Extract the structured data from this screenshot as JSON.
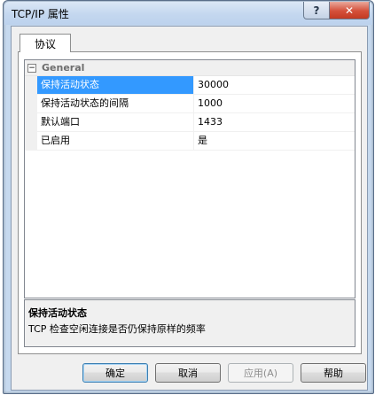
{
  "window": {
    "title": "TCP/IP 属性",
    "help_glyph": "?",
    "close_glyph": "✕"
  },
  "tabs": [
    {
      "label": "协议"
    }
  ],
  "grid": {
    "category": {
      "label": "General",
      "toggle": "−"
    },
    "properties": [
      {
        "name": "保持活动状态",
        "value": "30000",
        "selected": true
      },
      {
        "name": "保持活动状态的间隔",
        "value": "1000",
        "selected": false
      },
      {
        "name": "默认端口",
        "value": "1433",
        "selected": false
      },
      {
        "name": "已启用",
        "value": "是",
        "selected": false
      }
    ]
  },
  "description": {
    "title": "保持活动状态",
    "text": "TCP 检查空闲连接是否仍保持原样的频率"
  },
  "buttons": {
    "ok": "确定",
    "cancel": "取消",
    "apply": "应用(A)",
    "help": "帮助"
  }
}
